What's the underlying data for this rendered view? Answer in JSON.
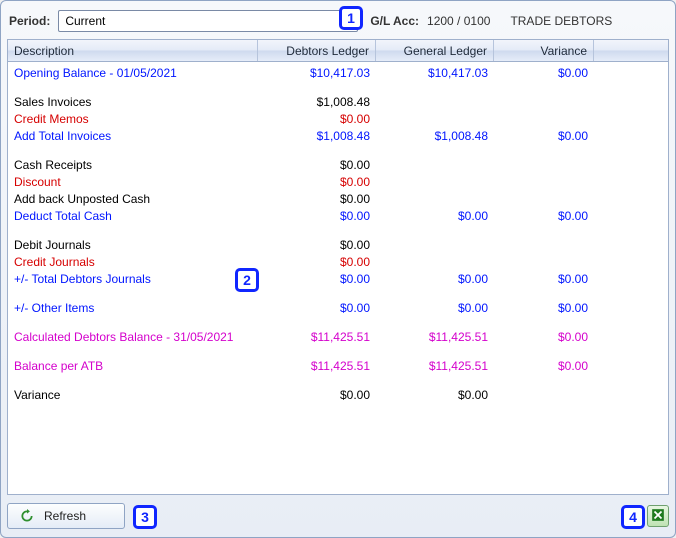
{
  "header": {
    "period_label": "Period:",
    "period_value": "Current",
    "gl_label": "G/L Acc:",
    "gl_value": "1200  / 0100",
    "gl_desc": "TRADE DEBTORS"
  },
  "columns": {
    "desc": "Description",
    "dl": "Debtors Ledger",
    "gl": "General Ledger",
    "var": "Variance"
  },
  "rows": [
    {
      "type": "data",
      "cls": "blue",
      "desc": "Opening Balance - 01/05/2021",
      "dl": "$10,417.03",
      "gl": "$10,417.03",
      "var": "$0.00"
    },
    {
      "type": "spacer"
    },
    {
      "type": "data",
      "cls": "black",
      "desc": "Sales Invoices",
      "dl": "$1,008.48",
      "gl": "",
      "var": ""
    },
    {
      "type": "data",
      "cls": "red",
      "desc": "Credit Memos",
      "dl": "$0.00",
      "gl": "",
      "var": ""
    },
    {
      "type": "data",
      "cls": "blue",
      "desc": "Add Total Invoices",
      "dl": "$1,008.48",
      "gl": "$1,008.48",
      "var": "$0.00"
    },
    {
      "type": "spacer"
    },
    {
      "type": "data",
      "cls": "black",
      "desc": "Cash Receipts",
      "dl": "$0.00",
      "gl": "",
      "var": ""
    },
    {
      "type": "data",
      "cls": "red",
      "desc": "Discount",
      "dl": "$0.00",
      "gl": "",
      "var": ""
    },
    {
      "type": "data",
      "cls": "black",
      "desc": "Add back Unposted Cash",
      "dl": "$0.00",
      "gl": "",
      "var": ""
    },
    {
      "type": "data",
      "cls": "blue",
      "desc": "Deduct Total Cash",
      "dl": "$0.00",
      "gl": "$0.00",
      "var": "$0.00"
    },
    {
      "type": "spacer"
    },
    {
      "type": "data",
      "cls": "black",
      "desc": "Debit Journals",
      "dl": "$0.00",
      "gl": "",
      "var": ""
    },
    {
      "type": "data",
      "cls": "red",
      "desc": "Credit Journals",
      "dl": "$0.00",
      "gl": "",
      "var": ""
    },
    {
      "type": "data",
      "cls": "blue",
      "desc": "+/- Total Debtors Journals",
      "dl": "$0.00",
      "gl": "$0.00",
      "var": "$0.00"
    },
    {
      "type": "spacer"
    },
    {
      "type": "data",
      "cls": "blue",
      "desc": "+/- Other Items",
      "dl": "$0.00",
      "gl": "$0.00",
      "var": "$0.00"
    },
    {
      "type": "spacer"
    },
    {
      "type": "data",
      "cls": "magenta",
      "desc": "Calculated Debtors Balance - 31/05/2021",
      "dl": "$11,425.51",
      "gl": "$11,425.51",
      "var": "$0.00"
    },
    {
      "type": "spacer"
    },
    {
      "type": "data",
      "cls": "magenta",
      "desc": "Balance per ATB",
      "dl": "$11,425.51",
      "gl": "$11,425.51",
      "var": "$0.00"
    },
    {
      "type": "spacer"
    },
    {
      "type": "data",
      "cls": "black",
      "desc": "Variance",
      "dl": "$0.00",
      "gl": "$0.00",
      "var": ""
    }
  ],
  "buttons": {
    "refresh": "Refresh"
  },
  "callouts": {
    "c1": "1",
    "c2": "2",
    "c3": "3",
    "c4": "4"
  }
}
